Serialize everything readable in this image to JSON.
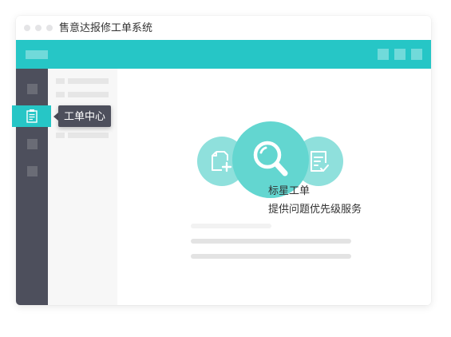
{
  "window": {
    "title": "售意达报修工单系统"
  },
  "colors": {
    "accent": "#26c6c6",
    "sidebar": "#4d4f5c",
    "circle_small": "#8fe0dc",
    "circle_large": "#63d6d0",
    "icon_white": "#ffffff"
  },
  "sidebar": {
    "active_item": {
      "icon": "clipboard-icon",
      "tooltip": "工单中心"
    }
  },
  "feature": {
    "title": "标星工单",
    "description": "提供问题优先级服务",
    "icons": [
      "add-file-icon",
      "search-icon",
      "checklist-icon"
    ]
  }
}
